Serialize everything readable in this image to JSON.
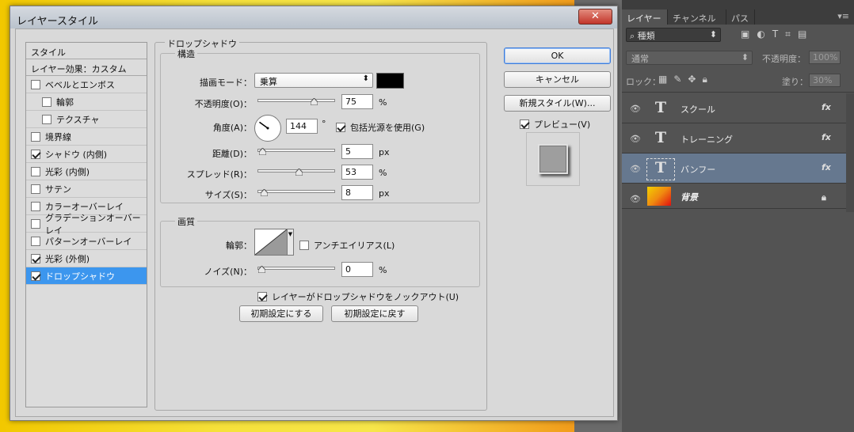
{
  "dialog": {
    "title": "レイヤースタイル",
    "close": "✕"
  },
  "styles": {
    "header": "スタイル",
    "effects_label": "レイヤー効果：カスタム",
    "items": [
      {
        "label": "ベベルとエンボス",
        "checked": false
      },
      {
        "label": "輪郭",
        "checked": false
      },
      {
        "label": "テクスチャ",
        "checked": false
      },
      {
        "label": "境界線",
        "checked": false
      },
      {
        "label": "シャドウ (内側)",
        "checked": true
      },
      {
        "label": "光彩 (内側)",
        "checked": false
      },
      {
        "label": "サテン",
        "checked": false
      },
      {
        "label": "カラーオーバーレイ",
        "checked": false
      },
      {
        "label": "グラデーションオーバーレイ",
        "checked": false
      },
      {
        "label": "パターンオーバーレイ",
        "checked": false
      },
      {
        "label": "光彩 (外側)",
        "checked": true
      },
      {
        "label": "ドロップシャドウ",
        "checked": true
      }
    ]
  },
  "drop_shadow": {
    "section_title": "ドロップシャドウ",
    "structure_title": "構造",
    "blend_mode_label": "描画モード：",
    "blend_mode_value": "乗算",
    "blend_color": "#000000",
    "opacity_label": "不透明度(O)：",
    "opacity_value": "75",
    "opacity_unit": "%",
    "opacity_level": 0.75,
    "angle_label": "角度(A)：",
    "angle_value": "144",
    "angle_unit": "°",
    "global_light_label": "包括光源を使用(G)",
    "global_light_checked": true,
    "distance_label": "距離(D)：",
    "distance_value": "5",
    "distance_unit": "px",
    "distance_level": 0.017,
    "spread_label": "スプレッド(R)：",
    "spread_value": "53",
    "spread_unit": "%",
    "spread_level": 0.53,
    "size_label": "サイズ(S)：",
    "size_value": "8",
    "size_unit": "px",
    "size_level": 0.032,
    "quality_title": "画質",
    "contour_label": "輪郭：",
    "antialias_label": "アンチエイリアス(L)",
    "antialias_checked": false,
    "noise_label": "ノイズ(N)：",
    "noise_value": "0",
    "noise_unit": "%",
    "noise_level": 0,
    "knockout_label": "レイヤーがドロップシャドウをノックアウト(U)",
    "knockout_checked": true,
    "make_default": "初期設定にする",
    "reset_default": "初期設定に戻す"
  },
  "buttons": {
    "ok": "OK",
    "cancel": "キャンセル",
    "new_style": "新規スタイル(W)...",
    "preview_label": "プレビュー(V)",
    "preview_checked": true
  },
  "layers_panel": {
    "tabs": [
      "レイヤー",
      "チャンネル",
      "パス"
    ],
    "kind": "種類",
    "blend_mode": "通常",
    "opacity_label": "不透明度：",
    "opacity_value": "100%",
    "lock_label": "ロック：",
    "fill_label": "塗り：",
    "fill_value": "30%",
    "layers": [
      {
        "name": "スクール",
        "fx": "fx",
        "selected": false
      },
      {
        "name": "トレーニング",
        "fx": "fx",
        "selected": false
      },
      {
        "name": "バンフー",
        "fx": "fx",
        "selected": true
      },
      {
        "name": "背景",
        "fx": "",
        "selected": false
      }
    ]
  }
}
